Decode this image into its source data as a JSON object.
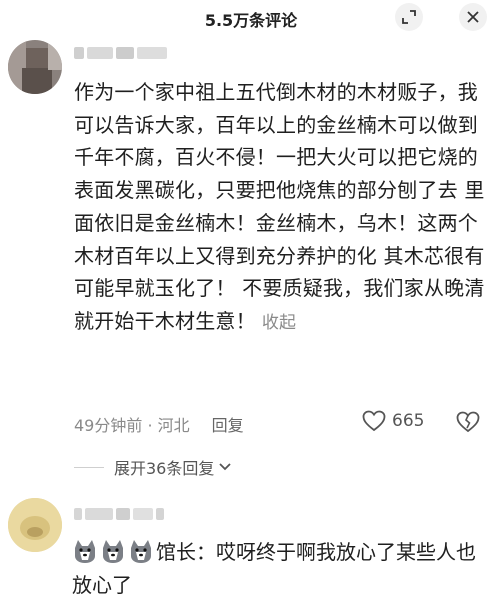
{
  "header": {
    "title": "5.5万条评论",
    "expand_icon": "expand-icon",
    "close_icon": "close-icon"
  },
  "comment": {
    "text": "作为一个家中祖上五代倒木材的木材贩子，我可以告诉大家，百年以上的金丝楠木可以做到千年不腐，百火不侵！一把大火可以把它烧的表面发黑碳化，只要把他烧焦的部分刨了去 里面依旧是金丝楠木！金丝楠木，乌木！这两个木材百年以上又得到充分养护的化 其木芯很有可能早就玉化了！  不要质疑我，我们家从晚清就开始干木材生意！",
    "collapse_label": "收起",
    "meta": "49分钟前 · 河北",
    "reply_label": "回复",
    "likes": "665"
  },
  "replies": {
    "expand_label": "展开36条回复"
  },
  "reply": {
    "text": "馆长：哎呀终于啊我放心了某些人也放心了",
    "emoji_icon": "husky-dog-emoji-icon"
  },
  "colors": {
    "text": "#1f1f1f",
    "muted": "#8a8a8a",
    "button_bg": "#f1f1f1"
  }
}
